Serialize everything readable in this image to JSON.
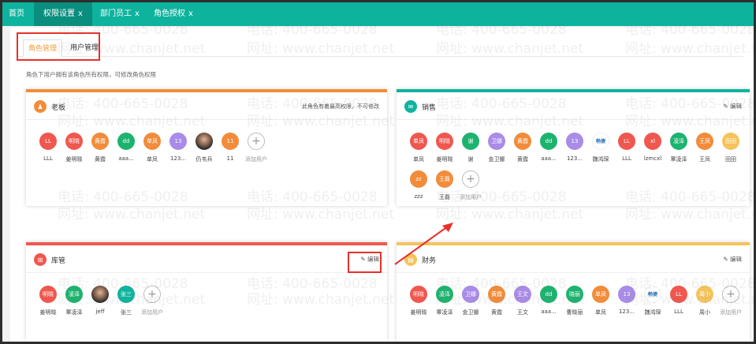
{
  "tabs": [
    {
      "label": "首页",
      "close": ""
    },
    {
      "label": "权限设置",
      "close": "x"
    },
    {
      "label": "部门员工",
      "close": "x"
    },
    {
      "label": "角色授权",
      "close": "x"
    }
  ],
  "subtabs": [
    "角色管理",
    "用户管理"
  ],
  "description": "角色下用户拥有该角色所有权限，可修改角色权限",
  "watermark": {
    "phone": "电话: 400-665-0028",
    "site": "网址: www.chanjet.net"
  },
  "edit_label": "编辑",
  "add_label": "添加用户",
  "roles": [
    {
      "title": "老板",
      "icon": "person-icon",
      "color": "#f28c3a",
      "note": "此角色有着最高权限，不可修改",
      "members": [
        {
          "avatar": "LL",
          "name": "LLL",
          "color": "#f0574f"
        },
        {
          "avatar": "明晓",
          "name": "姜明晓",
          "color": "#f0574f"
        },
        {
          "avatar": "黄霞",
          "name": "黄霞",
          "color": "#f28c3a"
        },
        {
          "avatar": "dd",
          "name": "aaa...",
          "color": "#1db36f"
        },
        {
          "avatar": "单凤",
          "name": "单凤",
          "color": "#f28c3a"
        },
        {
          "avatar": "13",
          "name": "123...",
          "color": "#a98be8"
        },
        {
          "avatar": "",
          "name": "仍韦兵",
          "color": "#2b2b2b",
          "type": "photo"
        },
        {
          "avatar": "11",
          "name": "11",
          "color": "#f28c3a"
        }
      ]
    },
    {
      "title": "销售",
      "icon": "chat-icon",
      "color": "#0eb39e",
      "members": [
        {
          "avatar": "单凤",
          "name": "单凤",
          "color": "#f0574f"
        },
        {
          "avatar": "明晓",
          "name": "姜明晓",
          "color": "#f0574f"
        },
        {
          "avatar": "谢",
          "name": "谢",
          "color": "#1db36f"
        },
        {
          "avatar": "卫娜",
          "name": "金卫娜",
          "color": "#a98be8"
        },
        {
          "avatar": "黄霞",
          "name": "黄霞",
          "color": "#f28c3a"
        },
        {
          "avatar": "dd",
          "name": "aaa...",
          "color": "#1db36f"
        },
        {
          "avatar": "13",
          "name": "123...",
          "color": "#a98be8"
        },
        {
          "avatar": "畅捷",
          "name": "魏鸿琛",
          "color": "#2a6fb5",
          "type": "logo"
        },
        {
          "avatar": "LL",
          "name": "LLL",
          "color": "#f0574f"
        },
        {
          "avatar": "xl",
          "name": "lzmcxl",
          "color": "#f0574f"
        },
        {
          "avatar": "凌泽",
          "name": "覃凌泽",
          "color": "#1db36f"
        },
        {
          "avatar": "王凤",
          "name": "王凤",
          "color": "#f28c3a"
        },
        {
          "avatar": "田田",
          "name": "田田",
          "color": "#f5c35c"
        },
        {
          "avatar": "zz",
          "name": "zzz",
          "color": "#f28c3a"
        },
        {
          "avatar": "王磊",
          "name": "王磊",
          "color": "#f28c3a"
        }
      ]
    },
    {
      "title": "库管",
      "icon": "cart-icon",
      "color": "#f0574f",
      "members": [
        {
          "avatar": "明晓",
          "name": "姜明晓",
          "color": "#f0574f"
        },
        {
          "avatar": "凌泽",
          "name": "覃凌泽",
          "color": "#1db36f"
        },
        {
          "avatar": "",
          "name": "jeff",
          "color": "#2b2b2b",
          "type": "photo"
        },
        {
          "avatar": "张三",
          "name": "张三",
          "color": "#0eb39e"
        }
      ]
    },
    {
      "title": "财务",
      "icon": "briefcase-icon",
      "color": "#f5c35c",
      "members": [
        {
          "avatar": "明晓",
          "name": "姜明晓",
          "color": "#f0574f"
        },
        {
          "avatar": "凌泽",
          "name": "覃凌泽",
          "color": "#1db36f"
        },
        {
          "avatar": "卫娜",
          "name": "金卫娜",
          "color": "#a98be8"
        },
        {
          "avatar": "黄霞",
          "name": "黄霞",
          "color": "#f28c3a"
        },
        {
          "avatar": "王文",
          "name": "王文",
          "color": "#a98be8"
        },
        {
          "avatar": "dd",
          "name": "aaa...",
          "color": "#1db36f"
        },
        {
          "avatar": "晓丽",
          "name": "曹晓丽",
          "color": "#1db36f"
        },
        {
          "avatar": "单凤",
          "name": "单凤",
          "color": "#f28c3a"
        },
        {
          "avatar": "13",
          "name": "123...",
          "color": "#a98be8"
        },
        {
          "avatar": "畅捷",
          "name": "魏鸿琛",
          "color": "#2a6fb5",
          "type": "logo"
        },
        {
          "avatar": "LL",
          "name": "LLL",
          "color": "#f0574f"
        },
        {
          "avatar": "周小",
          "name": "周小",
          "color": "#f5c35c"
        }
      ]
    }
  ]
}
